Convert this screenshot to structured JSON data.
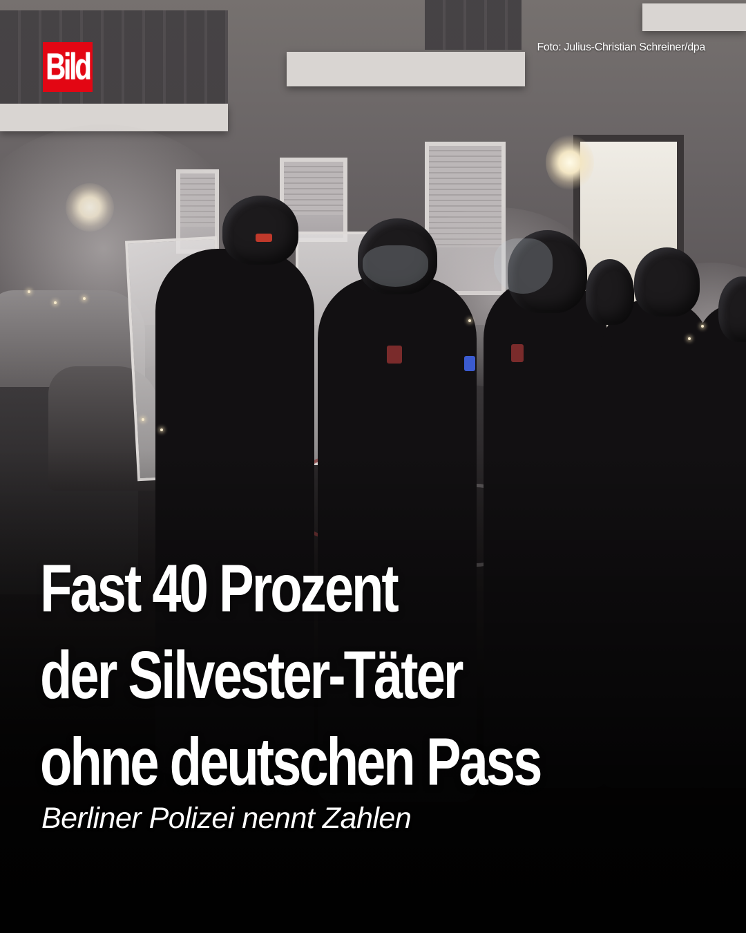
{
  "brand": {
    "logo_text": "Bild",
    "logo_color": "#e30613"
  },
  "photo": {
    "credit": "Foto: Julius-Christian Schreiner/dpa"
  },
  "headline": {
    "lines": [
      "Fast 40 Prozent",
      "der Silvester-Täter",
      "ohne deutschen Pass"
    ]
  },
  "subline": "Berliner Polizei nennt Zahlen"
}
